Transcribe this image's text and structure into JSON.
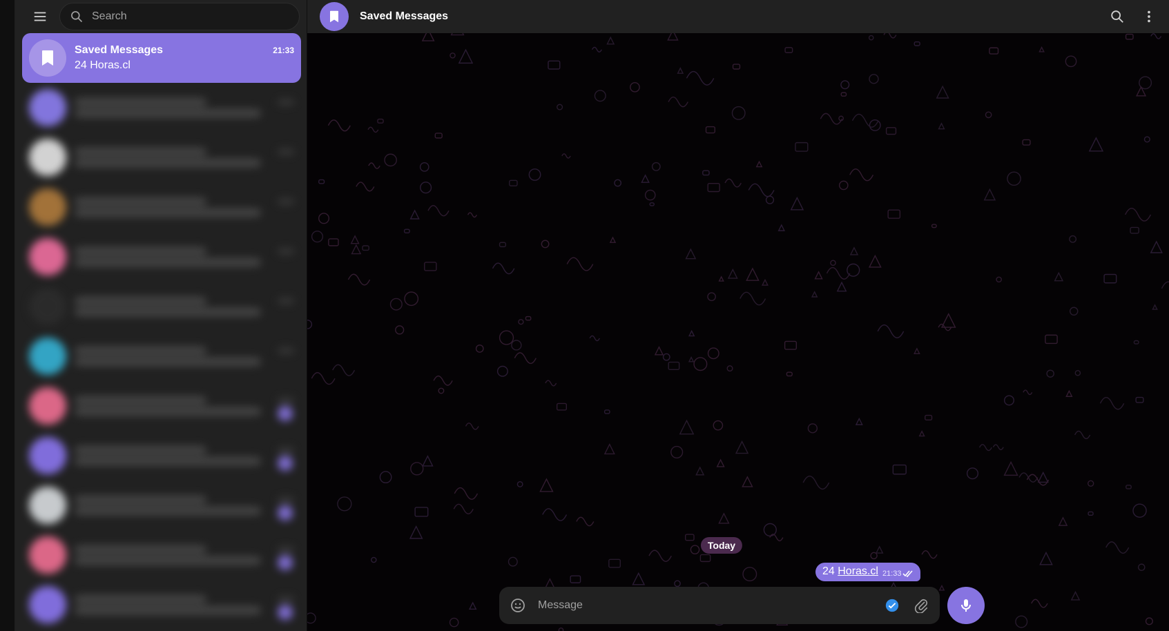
{
  "sidebar": {
    "search": {
      "placeholder": "Search",
      "value": ""
    },
    "active_chat": {
      "title": "Saved Messages",
      "preview": "24 Horas.cl",
      "time": "21:33"
    },
    "blurred_items": [
      {
        "avatar_color": "#8d7ff2",
        "badge": false
      },
      {
        "avatar_color": "#e6e6e6",
        "badge": false
      },
      {
        "avatar_color": "#b07b3c",
        "badge": false
      },
      {
        "avatar_color": "#f06fa0",
        "badge": false
      },
      {
        "avatar_color": "#2c2c2c",
        "badge": false
      },
      {
        "avatar_color": "#35b3d6",
        "badge": false
      },
      {
        "avatar_color": "#f06f93",
        "badge": true
      },
      {
        "avatar_color": "#8b76f0",
        "badge": true
      },
      {
        "avatar_color": "#d9dde0",
        "badge": true
      },
      {
        "avatar_color": "#f06f93",
        "badge": true
      },
      {
        "avatar_color": "#8b76f0",
        "badge": true
      }
    ]
  },
  "topbar": {
    "title": "Saved Messages"
  },
  "chat": {
    "date_label": "Today",
    "message": {
      "prefix": "24 ",
      "link": "Horas.cl",
      "time": "21:33"
    }
  },
  "composer": {
    "placeholder": "Message",
    "value": ""
  },
  "colors": {
    "accent": "#8774e1",
    "sidebar_bg": "#212121",
    "chat_bg": "#050305"
  }
}
